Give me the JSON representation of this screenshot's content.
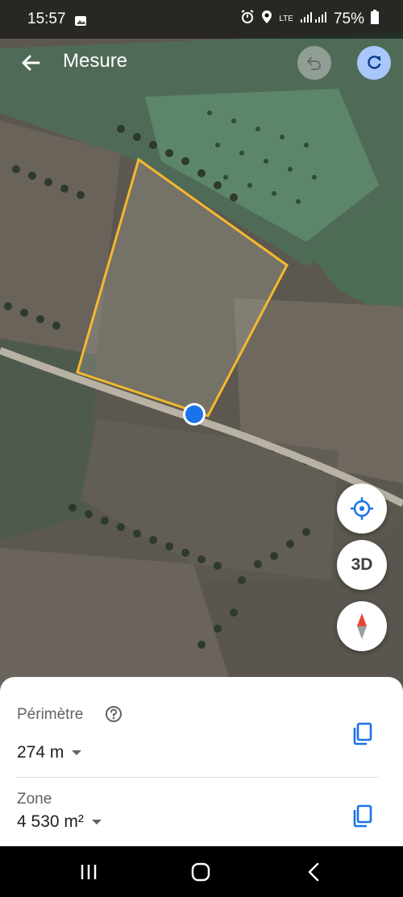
{
  "status_bar": {
    "time": "15:57",
    "network": "LTE",
    "battery": "75%"
  },
  "header": {
    "title": "Mesure"
  },
  "map_controls": {
    "three_d_label": "3D"
  },
  "measurements": {
    "perimeter_label": "Périmètre",
    "perimeter_value": "274 m",
    "area_label": "Zone",
    "area_value": "4 530 m²"
  },
  "colors": {
    "polygon_outline": "#f5b82e",
    "location_dot": "#1a73e8",
    "redo_button_bg": "#a8c7fa",
    "copy_icon": "#1a73e8"
  },
  "icons": {
    "back": "arrow-left-icon",
    "undo": "undo-icon",
    "redo": "redo-icon",
    "locate": "crosshair-icon",
    "compass": "compass-icon",
    "copy": "copy-icon",
    "help": "help-circle-icon"
  }
}
